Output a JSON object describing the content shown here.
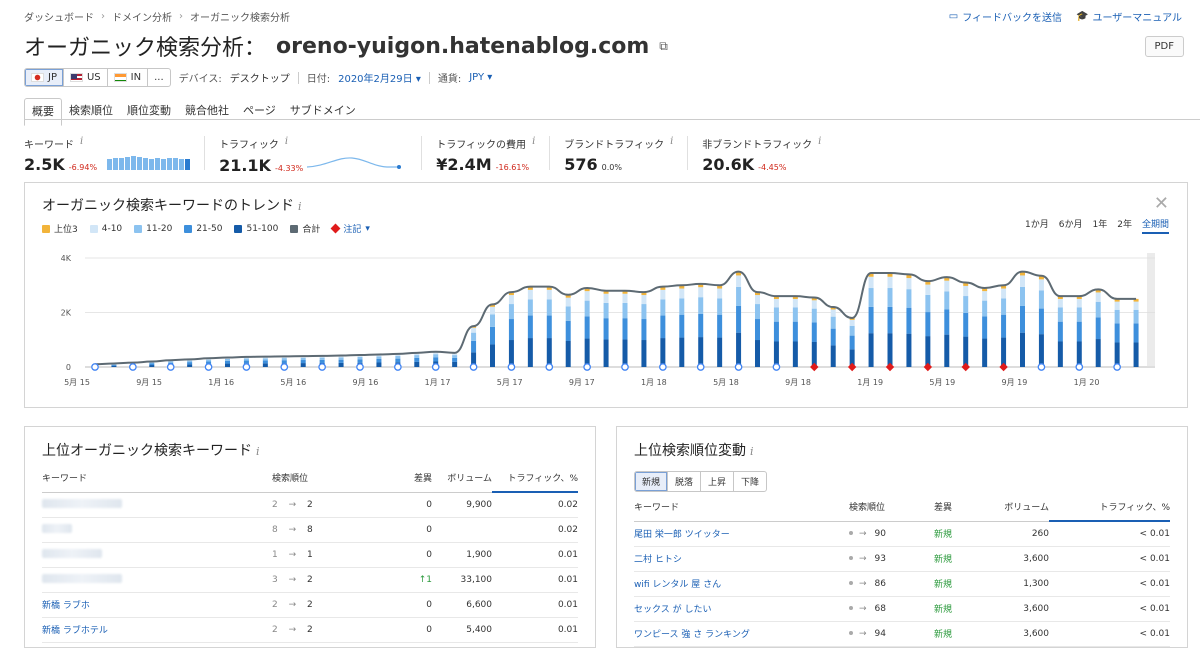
{
  "breadcrumb": [
    "ダッシュボード",
    "ドメイン分析",
    "オーガニック検索分析"
  ],
  "top_links": {
    "feedback": "フィードバックを送信",
    "manual": "ユーザーマニュアル"
  },
  "header": {
    "title": "オーガニック検索分析：",
    "domain": "oreno-yuigon.hatenablog.com",
    "pdf": "PDF"
  },
  "databases": [
    "JP",
    "US",
    "IN",
    "..."
  ],
  "filters": {
    "device_label": "デバイス:",
    "device_value": "デスクトップ",
    "date_label": "日付:",
    "date_value": "2020年2月29日",
    "currency_label": "通貨:",
    "currency_value": "JPY"
  },
  "tabs": [
    "概要",
    "検索順位",
    "順位変動",
    "競合他社",
    "ページ",
    "サブドメイン"
  ],
  "metrics": [
    {
      "label": "キーワード",
      "value": "2.5K",
      "change": "-6.94%"
    },
    {
      "label": "トラフィック",
      "value": "21.1K",
      "change": "-4.33%"
    },
    {
      "label": "トラフィックの費用",
      "value": "¥2.4M",
      "change": "-16.61%"
    },
    {
      "label": "ブランドトラフィック",
      "value": "576",
      "change": "0.0%"
    },
    {
      "label": "非ブランドトラフィック",
      "value": "20.6K",
      "change": "-4.45%"
    }
  ],
  "trend": {
    "title": "オーガニック検索キーワードのトレンド",
    "legend": [
      "上位3",
      "4-10",
      "11-20",
      "21-50",
      "51-100",
      "合計"
    ],
    "notes_label": "注記",
    "ranges": [
      "1か月",
      "6か月",
      "1年",
      "2年",
      "全期間"
    ],
    "selected_range": "全期間"
  },
  "chart_data": {
    "type": "bar",
    "ylim": [
      0,
      4000
    ],
    "yticks": [
      "0",
      "2K",
      "4K"
    ],
    "xticks": [
      "5月 15",
      "9月 15",
      "1月 16",
      "5月 16",
      "9月 16",
      "1月 17",
      "5月 17",
      "9月 17",
      "1月 18",
      "5月 18",
      "9月 18",
      "1月 19",
      "5月 19",
      "9月 19",
      "1月 20"
    ],
    "series_colors": {
      "top3": "#f2b43a",
      "r4_10": "#d2e6f7",
      "r11_20": "#8cc3f0",
      "r21_50": "#3d8fdc",
      "r51_100": "#155ba8",
      "total": "#5d6a73"
    },
    "totals": [
      100,
      130,
      160,
      200,
      250,
      280,
      320,
      350,
      370,
      380,
      390,
      400,
      410,
      420,
      440,
      460,
      480,
      520,
      560,
      520,
      1500,
      2300,
      2750,
      2950,
      2950,
      2650,
      2900,
      2800,
      2800,
      2750,
      2950,
      3000,
      3050,
      3000,
      3500,
      2750,
      2600,
      2600,
      2550,
      2200,
      1800,
      3450,
      3450,
      3400,
      3150,
      3300,
      3100,
      2900,
      3000,
      3500,
      3350,
      2600,
      2600,
      2850,
      2500,
      2500
    ]
  },
  "left_card": {
    "title": "上位オーガニック検索キーワード",
    "columns": [
      "キーワード",
      "検索順位",
      "差異",
      "ボリューム",
      "トラフィック、%"
    ],
    "rows": [
      {
        "keyword": "",
        "from": "2",
        "to": "2",
        "diff": "0",
        "volume": "9,900",
        "traffic": "0.02"
      },
      {
        "keyword": "",
        "from": "8",
        "to": "8",
        "diff": "0",
        "volume": "",
        "traffic": "0.02"
      },
      {
        "keyword": "",
        "from": "1",
        "to": "1",
        "diff": "0",
        "volume": "1,900",
        "traffic": "0.01"
      },
      {
        "keyword": "",
        "from": "3",
        "to": "2",
        "diff": "↑1",
        "volume": "33,100",
        "traffic": "0.01"
      },
      {
        "keyword": "新橋 ラブホ",
        "from": "2",
        "to": "2",
        "diff": "0",
        "volume": "6,600",
        "traffic": "0.01"
      },
      {
        "keyword": "新橋 ラブホテル",
        "from": "2",
        "to": "2",
        "diff": "0",
        "volume": "5,400",
        "traffic": "0.01"
      }
    ]
  },
  "right_card": {
    "title": "上位検索順位変動",
    "segments": [
      "新規",
      "脱落",
      "上昇",
      "下降"
    ],
    "columns": [
      "キーワード",
      "検索順位",
      "差異",
      "ボリューム",
      "トラフィック、%"
    ],
    "rows": [
      {
        "keyword": "尾田 栄一郎 ツイッター",
        "to": "90",
        "diff": "新規",
        "volume": "260",
        "traffic": "< 0.01"
      },
      {
        "keyword": "二村 ヒトシ",
        "to": "93",
        "diff": "新規",
        "volume": "3,600",
        "traffic": "< 0.01"
      },
      {
        "keyword": "wifi レンタル 屋 さん",
        "to": "86",
        "diff": "新規",
        "volume": "1,300",
        "traffic": "< 0.01"
      },
      {
        "keyword": "セックス が したい",
        "to": "68",
        "diff": "新規",
        "volume": "3,600",
        "traffic": "< 0.01"
      },
      {
        "keyword": "ワンピース 強 さ ランキング",
        "to": "94",
        "diff": "新規",
        "volume": "3,600",
        "traffic": "< 0.01"
      }
    ]
  }
}
